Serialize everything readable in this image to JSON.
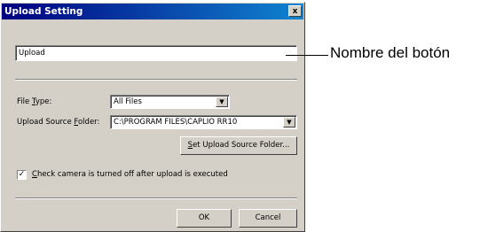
{
  "dialog": {
    "title": "Upload Setting",
    "close_label": "x",
    "button_name_field": {
      "value": "Upload"
    },
    "file_type": {
      "label_before": "File ",
      "label_accel": "T",
      "label_after": "ype:",
      "selected": "All Files"
    },
    "upload_source_folder": {
      "label_before": "Upload Source ",
      "label_accel": "F",
      "label_after": "older:",
      "selected": "C:\\PROGRAM FILES\\CAPLIO RR10"
    },
    "set_folder_button": {
      "label_accel": "S",
      "label_after": "et Upload Source Folder..."
    },
    "check_camera": {
      "checked": true,
      "check_mark": "✓",
      "label_accel": "C",
      "label_after": "heck camera is turned off after upload is executed"
    },
    "ok_label": "OK",
    "cancel_label": "Cancel",
    "dropdown_arrow": "▼"
  },
  "annotation": {
    "text": "Nombre del botón"
  }
}
